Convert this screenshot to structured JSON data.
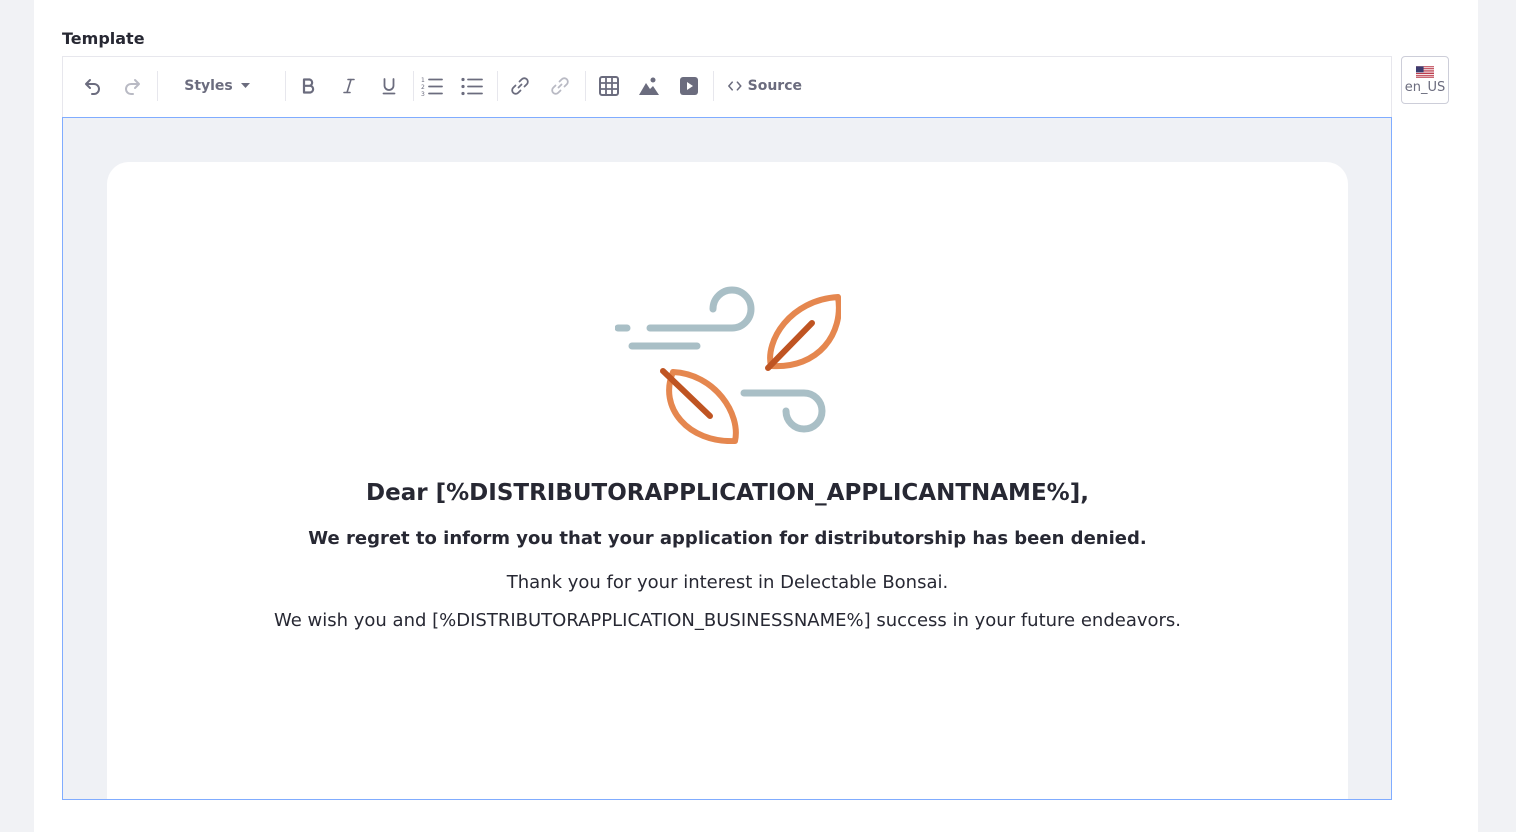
{
  "field": {
    "label": "Template"
  },
  "toolbar": {
    "styles_label": "Styles",
    "source_label": "Source",
    "buttons": [
      "undo-icon",
      "redo-icon",
      "bold-icon",
      "italic-icon",
      "underline-icon",
      "numbered-list-icon",
      "bulleted-list-icon",
      "link-icon",
      "unlink-icon",
      "table-icon",
      "image-icon",
      "video-icon",
      "code-icon"
    ]
  },
  "language": {
    "code": "en_US",
    "flag": "us-flag-icon"
  },
  "email": {
    "greeting": "Dear [%DISTRIBUTORAPPLICATION_APPLICANTNAME%],",
    "regret": "We regret to inform you that your application for distributorship has been denied.",
    "thanks": "Thank you for your interest in Delectable Bonsai.",
    "wish": "We wish you and [%DISTRIBUTORAPPLICATION_BUSINESSNAME%] success in your future endeavors."
  },
  "colors": {
    "editor_border": "#80acff",
    "leaf_light": "#e5874f",
    "leaf_dark": "#bf5422",
    "wind": "#a9bfc6"
  }
}
